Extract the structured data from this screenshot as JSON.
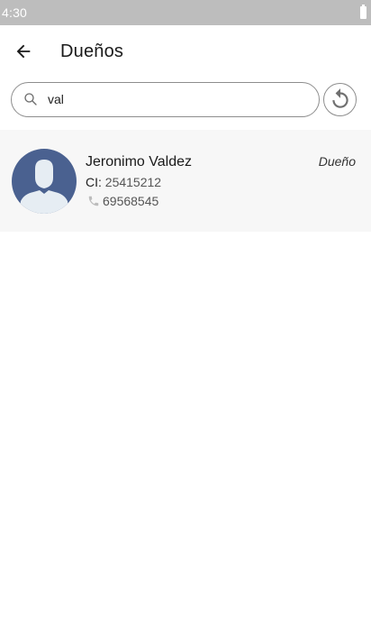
{
  "status_bar": {
    "time": "4:30",
    "battery_icon": "battery-icon"
  },
  "app_bar": {
    "back_icon": "arrow-left-icon",
    "title": "Dueños"
  },
  "search": {
    "icon": "search-icon",
    "value": "val",
    "reset_icon": "refresh-icon"
  },
  "owners": [
    {
      "avatar_icon": "avatar-placeholder-icon",
      "name": "Jeronimo Valdez",
      "ci_label": "CI:",
      "ci_value": "25415212",
      "phone_icon": "phone-icon",
      "phone": "69568545",
      "role": "Dueño"
    }
  ],
  "colors": {
    "status_bar": "#bdbdbd",
    "card_background": "#f7f7f7",
    "avatar_background": "#4a6190",
    "border": "#8e8e8e"
  }
}
